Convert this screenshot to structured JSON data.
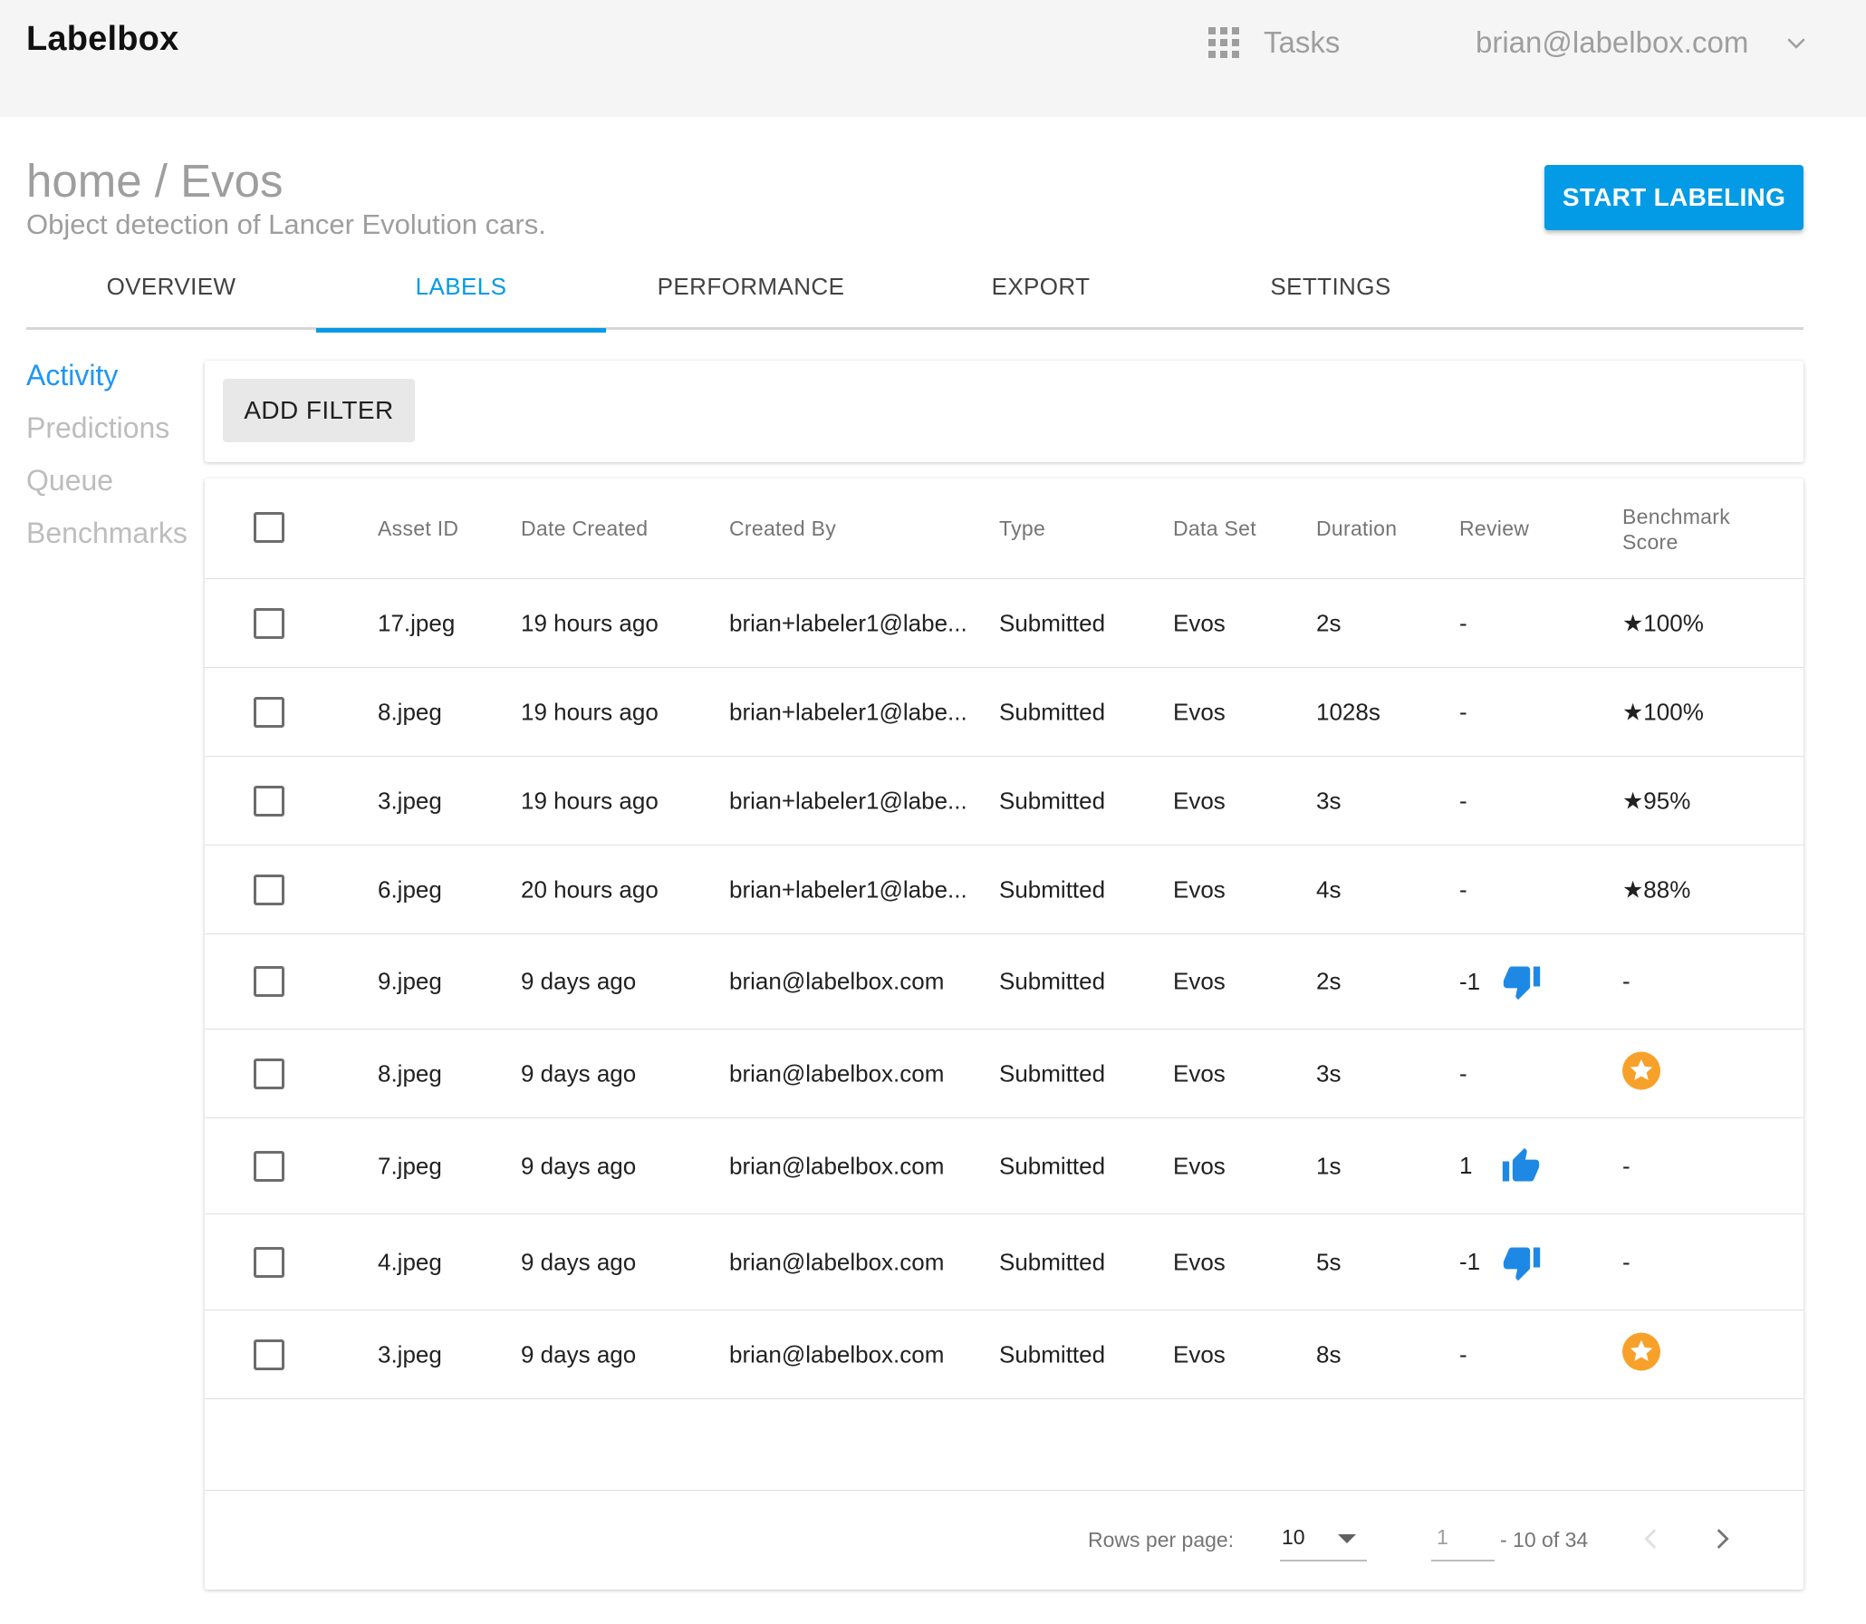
{
  "header": {
    "logo": "Labelbox",
    "tasks_label": "Tasks",
    "user_email": "brian@labelbox.com"
  },
  "project": {
    "breadcrumb": "home / Evos",
    "description": "Object detection of Lancer Evolution cars.",
    "start_button": "START LABELING"
  },
  "tabs": [
    {
      "label": "OVERVIEW"
    },
    {
      "label": "LABELS"
    },
    {
      "label": "PERFORMANCE"
    },
    {
      "label": "EXPORT"
    },
    {
      "label": "SETTINGS"
    }
  ],
  "active_tab": "LABELS",
  "sidenav": [
    {
      "label": "Activity"
    },
    {
      "label": "Predictions"
    },
    {
      "label": "Queue"
    },
    {
      "label": "Benchmarks"
    }
  ],
  "filter": {
    "button": "ADD FILTER"
  },
  "table": {
    "columns": [
      "Asset ID",
      "Date Created",
      "Created By",
      "Type",
      "Data Set",
      "Duration",
      "Review",
      "Benchmark",
      "Score"
    ],
    "rows": [
      {
        "asset": "17.jpeg",
        "date": "19 hours ago",
        "by": "brian+labeler1@labe...",
        "type": "Submitted",
        "dataset": "Evos",
        "duration": "2s",
        "review": "-",
        "benchmark": "★100%"
      },
      {
        "asset": "8.jpeg",
        "date": "19 hours ago",
        "by": "brian+labeler1@labe...",
        "type": "Submitted",
        "dataset": "Evos",
        "duration": "1028s",
        "review": "-",
        "benchmark": "★100%"
      },
      {
        "asset": "3.jpeg",
        "date": "19 hours ago",
        "by": "brian+labeler1@labe...",
        "type": "Submitted",
        "dataset": "Evos",
        "duration": "3s",
        "review": "-",
        "benchmark": "★95%"
      },
      {
        "asset": "6.jpeg",
        "date": "20 hours ago",
        "by": "brian+labeler1@labe...",
        "type": "Submitted",
        "dataset": "Evos",
        "duration": "4s",
        "review": "-",
        "benchmark": "★88%"
      },
      {
        "asset": "9.jpeg",
        "date": "9 days ago",
        "by": "brian@labelbox.com",
        "type": "Submitted",
        "dataset": "Evos",
        "duration": "2s",
        "review": "-1",
        "review_icon": "thumb-down-icon",
        "benchmark": "-"
      },
      {
        "asset": "8.jpeg",
        "date": "9 days ago",
        "by": "brian@labelbox.com",
        "type": "Submitted",
        "dataset": "Evos",
        "duration": "3s",
        "review": "-",
        "benchmark_icon": "benchmark-star-icon"
      },
      {
        "asset": "7.jpeg",
        "date": "9 days ago",
        "by": "brian@labelbox.com",
        "type": "Submitted",
        "dataset": "Evos",
        "duration": "1s",
        "review": "1",
        "review_icon": "thumb-up-icon",
        "benchmark": "-"
      },
      {
        "asset": "4.jpeg",
        "date": "9 days ago",
        "by": "brian@labelbox.com",
        "type": "Submitted",
        "dataset": "Evos",
        "duration": "5s",
        "review": "-1",
        "review_icon": "thumb-down-icon",
        "benchmark": "-"
      },
      {
        "asset": "3.jpeg",
        "date": "9 days ago",
        "by": "brian@labelbox.com",
        "type": "Submitted",
        "dataset": "Evos",
        "duration": "8s",
        "review": "-",
        "benchmark_icon": "benchmark-star-icon"
      }
    ]
  },
  "pagination": {
    "rows_per_page_label": "Rows per page:",
    "rows_per_page": "10",
    "page": "1",
    "range": "- 10 of 34"
  },
  "colors": {
    "accent": "#039be5",
    "thumb": "#1e88e5",
    "benchmark_badge": "#f7a12b"
  }
}
